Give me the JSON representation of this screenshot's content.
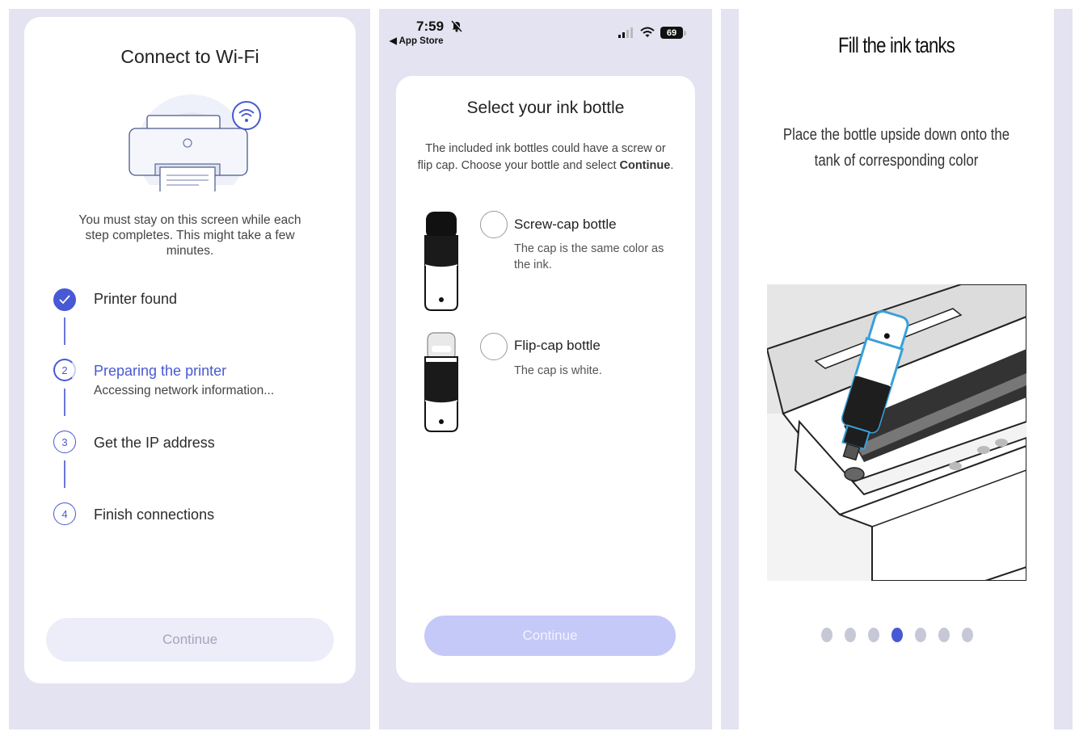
{
  "wifi_screen": {
    "title": "Connect to Wi-Fi",
    "note": "You must stay on this screen while each step completes. This might take a few minutes.",
    "steps": [
      {
        "number": "",
        "label": "Printer found",
        "status": "done",
        "sub": ""
      },
      {
        "number": "2",
        "label": "Preparing the printer",
        "status": "active",
        "sub": "Accessing network information..."
      },
      {
        "number": "3",
        "label": "Get the IP address",
        "status": "pending",
        "sub": ""
      },
      {
        "number": "4",
        "label": "Finish connections",
        "status": "pending",
        "sub": ""
      }
    ],
    "continue_label": "Continue",
    "accent_color": "#4759d4"
  },
  "ink_screen": {
    "status_bar": {
      "time": "7:59",
      "back_label": "◀ App Store",
      "battery": "69"
    },
    "title": "Select your ink bottle",
    "description_prefix": "The included ink bottles could have a screw or flip cap. Choose your bottle and select ",
    "description_bold": "Continue",
    "description_suffix": ".",
    "options": [
      {
        "title": "Screw-cap bottle",
        "description": "The cap is the same color as the ink."
      },
      {
        "title": "Flip-cap bottle",
        "description": "The cap is white."
      }
    ],
    "continue_label": "Continue"
  },
  "fill_screen": {
    "title": "Fill the ink tanks",
    "description": "Place the bottle upside down onto the tank of corresponding color",
    "page_count": 7,
    "current_page": 4
  }
}
